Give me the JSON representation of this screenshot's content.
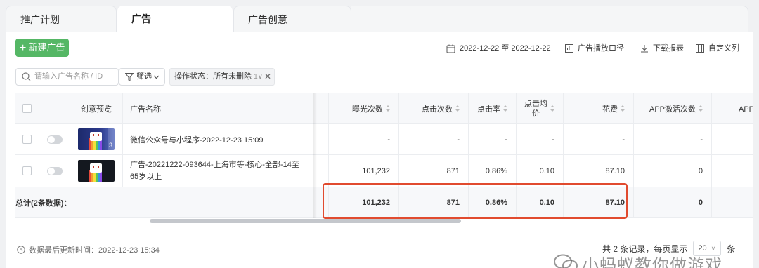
{
  "tabs": [
    {
      "label": "推广计划"
    },
    {
      "label": "广告"
    },
    {
      "label": "广告创意"
    }
  ],
  "toolbar": {
    "new_label": "新建广告",
    "date_range": "2022-12-22 至 2022-12-22",
    "report_caliber": "广告播放口径",
    "download": "下载报表",
    "custom_columns": "自定义列"
  },
  "filters": {
    "search_placeholder": "请输入广告名称 / ID",
    "filter_label": "筛选",
    "status_tag": "操作状态：所有未删除",
    "status_caret": "1∨"
  },
  "table": {
    "headers": {
      "preview": "创意预览",
      "name": "广告名称",
      "impressions": "曝光次数",
      "clicks": "点击次数",
      "ctr": "点击率",
      "cpc_line1": "点击均",
      "cpc_line2": "价",
      "cost": "花费",
      "app_activations": "APP激活次数",
      "app_more": "APP点"
    },
    "rows": [
      {
        "name": "微信公众号与小程序-2022-12-23 15:09",
        "thumb_count": "3",
        "impressions": "-",
        "clicks": "-",
        "ctr": "-",
        "cpc": "-",
        "cost": "-",
        "app_activations": "-"
      },
      {
        "name_line1": "广告-20221222-093644-上海市等-核心-全部-14至",
        "name_line2": "65岁以上",
        "impressions": "101,232",
        "clicks": "871",
        "ctr": "0.86%",
        "cpc": "0.10",
        "cost": "87.10",
        "app_activations": "0"
      }
    ],
    "total": {
      "label": "总计(2条数据)：",
      "impressions": "101,232",
      "clicks": "871",
      "ctr": "0.86%",
      "cpc": "0.10",
      "cost": "87.10",
      "app_activations": "0"
    }
  },
  "footer": {
    "updated": "数据最后更新时间：2022-12-23 15:34",
    "records": "共 2 条记录，每页显示",
    "page_size": "20",
    "unit": "条"
  },
  "watermark": "小蚂蚁教你做游戏",
  "colors": {
    "primary_green": "#55b765",
    "highlight_red": "#e14b2f"
  }
}
